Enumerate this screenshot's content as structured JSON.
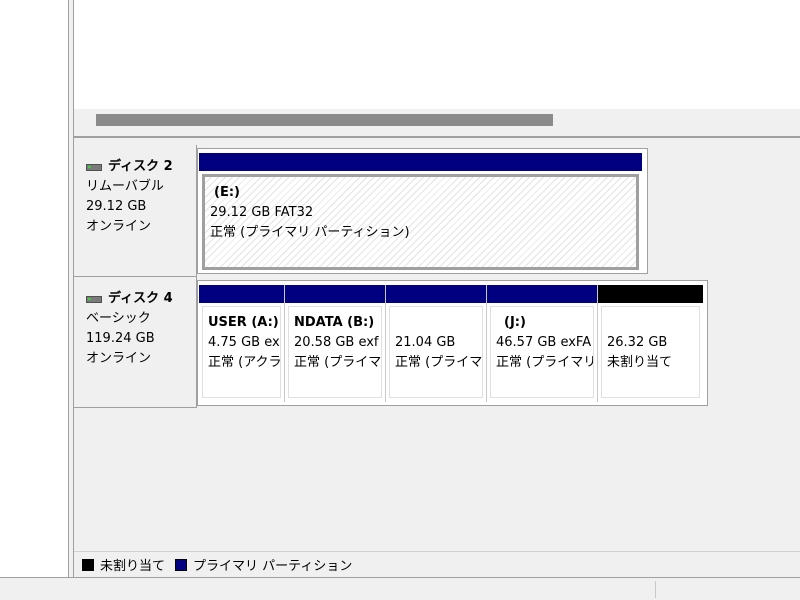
{
  "disks": [
    {
      "name": "ディスク 2",
      "type": "リムーバブル",
      "size": "29.12 GB",
      "status": "オンライン",
      "partitions": [
        {
          "name": "(E:)",
          "line1": "29.12 GB FAT32",
          "line2": "正常 (プライマリ パーティション)",
          "kind": "primary",
          "selected": true
        }
      ]
    },
    {
      "name": "ディスク 4",
      "type": "ベーシック",
      "size": "119.24 GB",
      "status": "オンライン",
      "partitions": [
        {
          "name": "USER  (A:)",
          "line1": "4.75 GB ex",
          "line2": "正常 (アクラ",
          "kind": "primary"
        },
        {
          "name": "NDATA  (B:)",
          "line1": "20.58 GB exf",
          "line2": "正常 (プライマ",
          "kind": "primary"
        },
        {
          "name": "",
          "line1": "21.04 GB",
          "line2": "正常 (プライマ",
          "kind": "primary"
        },
        {
          "name": "(J:)",
          "line1": "46.57 GB exFA",
          "line2": "正常 (プライマリ",
          "kind": "primary"
        },
        {
          "name": "",
          "line1": "26.32 GB",
          "line2": "未割り当て",
          "kind": "unallocated"
        }
      ]
    }
  ],
  "legend": [
    {
      "label": "未割り当て",
      "color": "#000000"
    },
    {
      "label": "プライマリ パーティション",
      "color": "#000080"
    }
  ],
  "colors": {
    "primary": "#000080",
    "unallocated": "#000000"
  }
}
